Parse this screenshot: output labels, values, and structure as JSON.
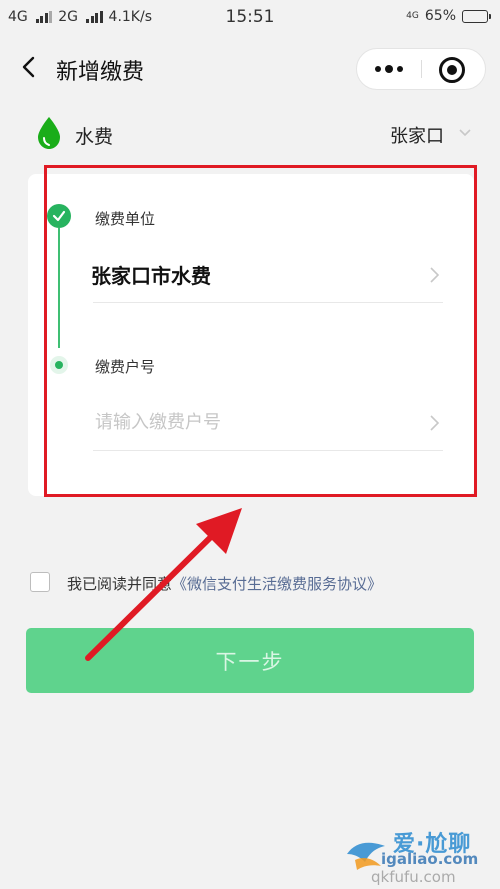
{
  "status_bar": {
    "network1": "4G",
    "network2": "2G",
    "speed": "4.1K/s",
    "time": "15:51",
    "lte_label": "4G",
    "battery": "65%",
    "battery_level": 0.65
  },
  "nav": {
    "title": "新增缴费",
    "back_icon": "chevron-left-icon",
    "more_icon": "more-dots-icon",
    "close_icon": "target-close-icon"
  },
  "category": {
    "icon": "water-drop-icon",
    "label": "水费",
    "city": "张家口",
    "accent": "#1aad19"
  },
  "form": {
    "step1_label": "缴费单位",
    "step1_value": "张家口市水费",
    "step2_label": "缴费户号",
    "step2_placeholder": "请输入缴费户号",
    "step2_value": ""
  },
  "agreement": {
    "checked": false,
    "text": "我已阅读并同意",
    "link": "《微信支付生活缴费服务协议》"
  },
  "next_button": {
    "label": "下一步",
    "color": "#5fd38d"
  },
  "annotation": {
    "highlight_color": "#e01a24"
  },
  "watermark": {
    "top": "爱·尬聊",
    "mid": "igaliao.com",
    "bot": "qkfufu.com"
  }
}
